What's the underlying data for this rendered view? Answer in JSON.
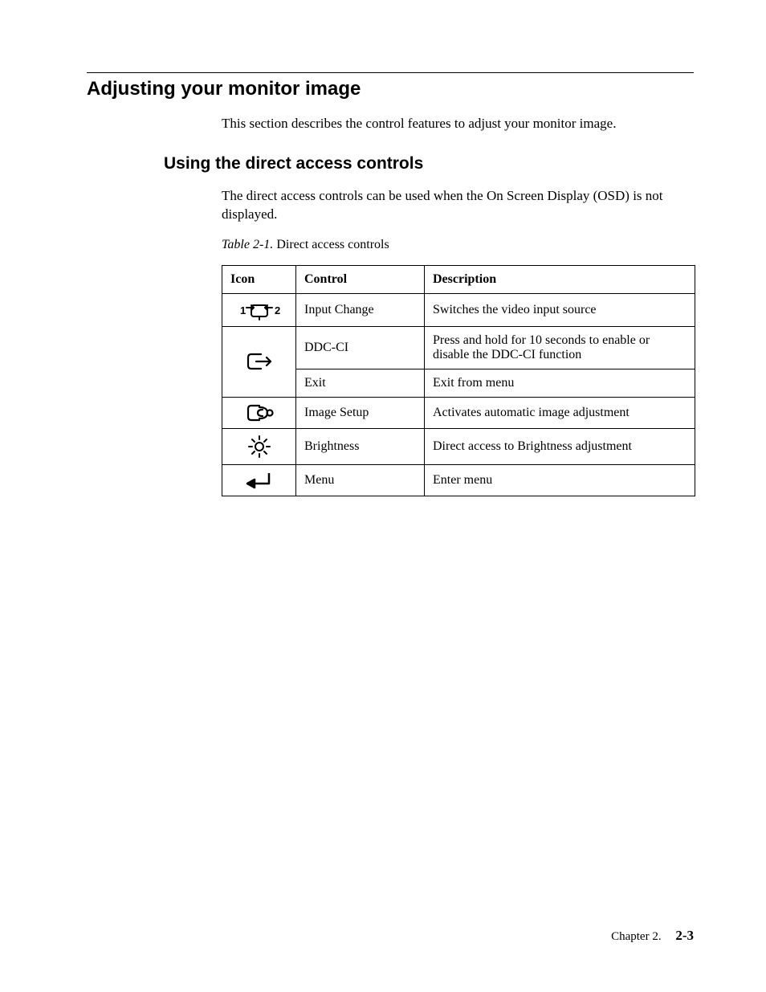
{
  "section_title": "Adjusting your monitor image",
  "section_intro": "This section describes the control features to adjust your monitor image.",
  "subsection_title": "Using the direct access controls",
  "subsection_body": "The direct access controls can be used when the On Screen Display (OSD) is not displayed.",
  "table_caption_label": "Table 2-1.",
  "table_caption_text": "Direct access controls",
  "headers": {
    "icon": "Icon",
    "control": "Control",
    "description": "Description"
  },
  "rows": [
    {
      "icon": "input-change-icon",
      "control": "Input Change",
      "description": "Switches the video input source"
    },
    {
      "icon": "exit-icon",
      "control": "DDC-CI",
      "description": "Press and hold for 10 seconds to enable or disable the DDC-CI function"
    },
    {
      "icon": "exit-icon",
      "control": "Exit",
      "description": "Exit from menu"
    },
    {
      "icon": "image-setup-icon",
      "control": "Image Setup",
      "description": "Activates automatic image adjustment"
    },
    {
      "icon": "brightness-icon",
      "control": "Brightness",
      "description": "Direct access to Brightness adjustment"
    },
    {
      "icon": "menu-icon",
      "control": "Menu",
      "description": "Enter menu"
    }
  ],
  "footer_chapter": "Chapter 2.",
  "footer_page": "2-3"
}
